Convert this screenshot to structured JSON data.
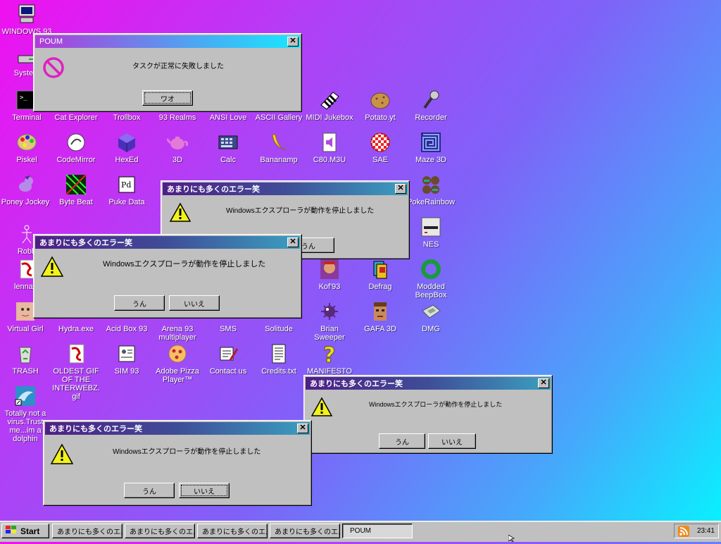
{
  "desktop_icons": [
    {
      "id": "windows93",
      "label": "WINDOWS 93",
      "icon": "computer-icon"
    },
    {
      "id": "system",
      "label": "System",
      "icon": "drive-icon"
    },
    {
      "id": "terminal",
      "label": "Terminal",
      "icon": "terminal-icon"
    },
    {
      "id": "cat-explorer",
      "label": "Cat Explorer",
      "icon": "cat-icon"
    },
    {
      "id": "trollbox",
      "label": "Trollbox",
      "icon": "chat-icon"
    },
    {
      "id": "93realms",
      "label": "93 Realms",
      "icon": "game-icon"
    },
    {
      "id": "ansi-love",
      "label": "ANSI Love",
      "icon": "ansi-icon"
    },
    {
      "id": "ascii-gallery",
      "label": "ASCII Gallery",
      "icon": "gallery-icon"
    },
    {
      "id": "midi-jukebox",
      "label": "MIDI Jukebox",
      "icon": "piano-icon"
    },
    {
      "id": "potato",
      "label": "Potato.yt",
      "icon": "potato-icon"
    },
    {
      "id": "recorder",
      "label": "Recorder",
      "icon": "microphone-icon"
    },
    {
      "id": "piskel",
      "label": "Piskel",
      "icon": "palette-icon"
    },
    {
      "id": "codemirror",
      "label": "CodeMirror",
      "icon": "codemirror-icon"
    },
    {
      "id": "hexed",
      "label": "HexEd",
      "icon": "hex-cube-icon"
    },
    {
      "id": "3d",
      "label": "3D",
      "icon": "teapot-icon"
    },
    {
      "id": "calc",
      "label": "Calc",
      "icon": "calculator-icon"
    },
    {
      "id": "bananamp",
      "label": "Bananamp",
      "icon": "banana-icon"
    },
    {
      "id": "c80m3u",
      "label": "C80.M3U",
      "icon": "audio-file-icon"
    },
    {
      "id": "sae",
      "label": "SAE",
      "icon": "ball-icon"
    },
    {
      "id": "maze3d",
      "label": "Maze 3D",
      "icon": "maze-icon"
    },
    {
      "id": "poney-jockey",
      "label": "Poney Jockey",
      "icon": "pony-icon"
    },
    {
      "id": "byte-beat",
      "label": "Byte Beat",
      "icon": "bytebeat-icon"
    },
    {
      "id": "puke-data",
      "label": "Puke Data",
      "icon": "pd-icon"
    },
    {
      "id": "pokerainbow",
      "label": "PokeRainbow",
      "icon": "pokerainbow-icon"
    },
    {
      "id": "robby",
      "label": "Robb",
      "icon": "robot-icon"
    },
    {
      "id": "nes",
      "label": "NES",
      "icon": "nes-icon"
    },
    {
      "id": "lenna",
      "label": "lenna.p",
      "icon": "lenna-icon"
    },
    {
      "id": "kof93",
      "label": "Kof'93",
      "icon": "fighter-icon"
    },
    {
      "id": "defrag",
      "label": "Defrag",
      "icon": "defrag-icon"
    },
    {
      "id": "modded-beepbox",
      "label": "Modded BeepBox",
      "icon": "ring-icon"
    },
    {
      "id": "virtual-girl",
      "label": "Virtual Girl",
      "icon": "face-icon"
    },
    {
      "id": "hydra",
      "label": "Hydra.exe",
      "icon": "hydra-icon"
    },
    {
      "id": "acid-box",
      "label": "Acid Box 93",
      "icon": "acid-icon"
    },
    {
      "id": "arena93",
      "label": "Arena 93 multiplayer",
      "icon": "arena-icon"
    },
    {
      "id": "sms",
      "label": "SMS",
      "icon": "sms-icon"
    },
    {
      "id": "solitude",
      "label": "Solitude",
      "icon": "cards-icon"
    },
    {
      "id": "brian-sweeper",
      "label": "Brian Sweeper",
      "icon": "mine-icon"
    },
    {
      "id": "gafa3d",
      "label": "GAFA 3D",
      "icon": "doomguy-icon"
    },
    {
      "id": "dmg",
      "label": "DMG",
      "icon": "gameboy-icon"
    },
    {
      "id": "trash",
      "label": "TRASH",
      "icon": "recycle-bin-icon"
    },
    {
      "id": "oldest-gif",
      "label": "OLDEST GIF OF THE INTERWEBZ.gif",
      "icon": "gif-file-icon"
    },
    {
      "id": "sim93",
      "label": "SIM 93",
      "icon": "book-icon"
    },
    {
      "id": "adobe-pizza",
      "label": "Adobe Pizza Player™",
      "icon": "pizza-icon"
    },
    {
      "id": "contact",
      "label": "Contact us",
      "icon": "contact-icon"
    },
    {
      "id": "credits",
      "label": "Credits.txt",
      "icon": "text-file-icon"
    },
    {
      "id": "manifesto",
      "label": "MANIFESTO",
      "icon": "question-icon"
    },
    {
      "id": "dolphin",
      "label": "Totally not a virus.Trust me...im a dolphin",
      "icon": "dolphin-icon"
    }
  ],
  "poum_dialog": {
    "title": "POUM",
    "message": "タスクが正常に失敗しました",
    "button": "ワオ",
    "icon": "prohibited-icon"
  },
  "error_dialogs": [
    {
      "title": "あまりにも多くのエラー笑",
      "message": "Windowsエクスプローラが動作を停止しました",
      "yes": "うん",
      "no": "いいえ"
    },
    {
      "title": "あまりにも多くのエラー笑",
      "message": "Windowsエクスプローラが動作を停止しました",
      "yes": "うん",
      "no": "いいえ"
    },
    {
      "title": "あまりにも多くのエラー笑",
      "message": "Windowsエクスプローラが動作を停止しました",
      "yes": "うん",
      "no": "いいえ"
    },
    {
      "title": "あまりにも多くのエラー笑",
      "message": "Windowsエクスプローラが動作を停止しました",
      "yes": "うん",
      "no": "いいえ"
    }
  ],
  "taskbar": {
    "start_label": "Start",
    "buttons": [
      "あまりにも多くのエ...",
      "あまりにも多くのエ...",
      "あまりにも多くのエ...",
      "あまりにも多くのエ...",
      "POUM"
    ],
    "clock": "23:41",
    "tray_icon": "rss-icon"
  },
  "colors": {
    "window_face": "#c0c0c0",
    "poum_title_gradient": [
      "#b23ad8",
      "#16e9ff"
    ],
    "error_title_gradient": [
      "#4e1f86",
      "#3aa0c0"
    ],
    "warning_yellow": "#f2f21a"
  }
}
